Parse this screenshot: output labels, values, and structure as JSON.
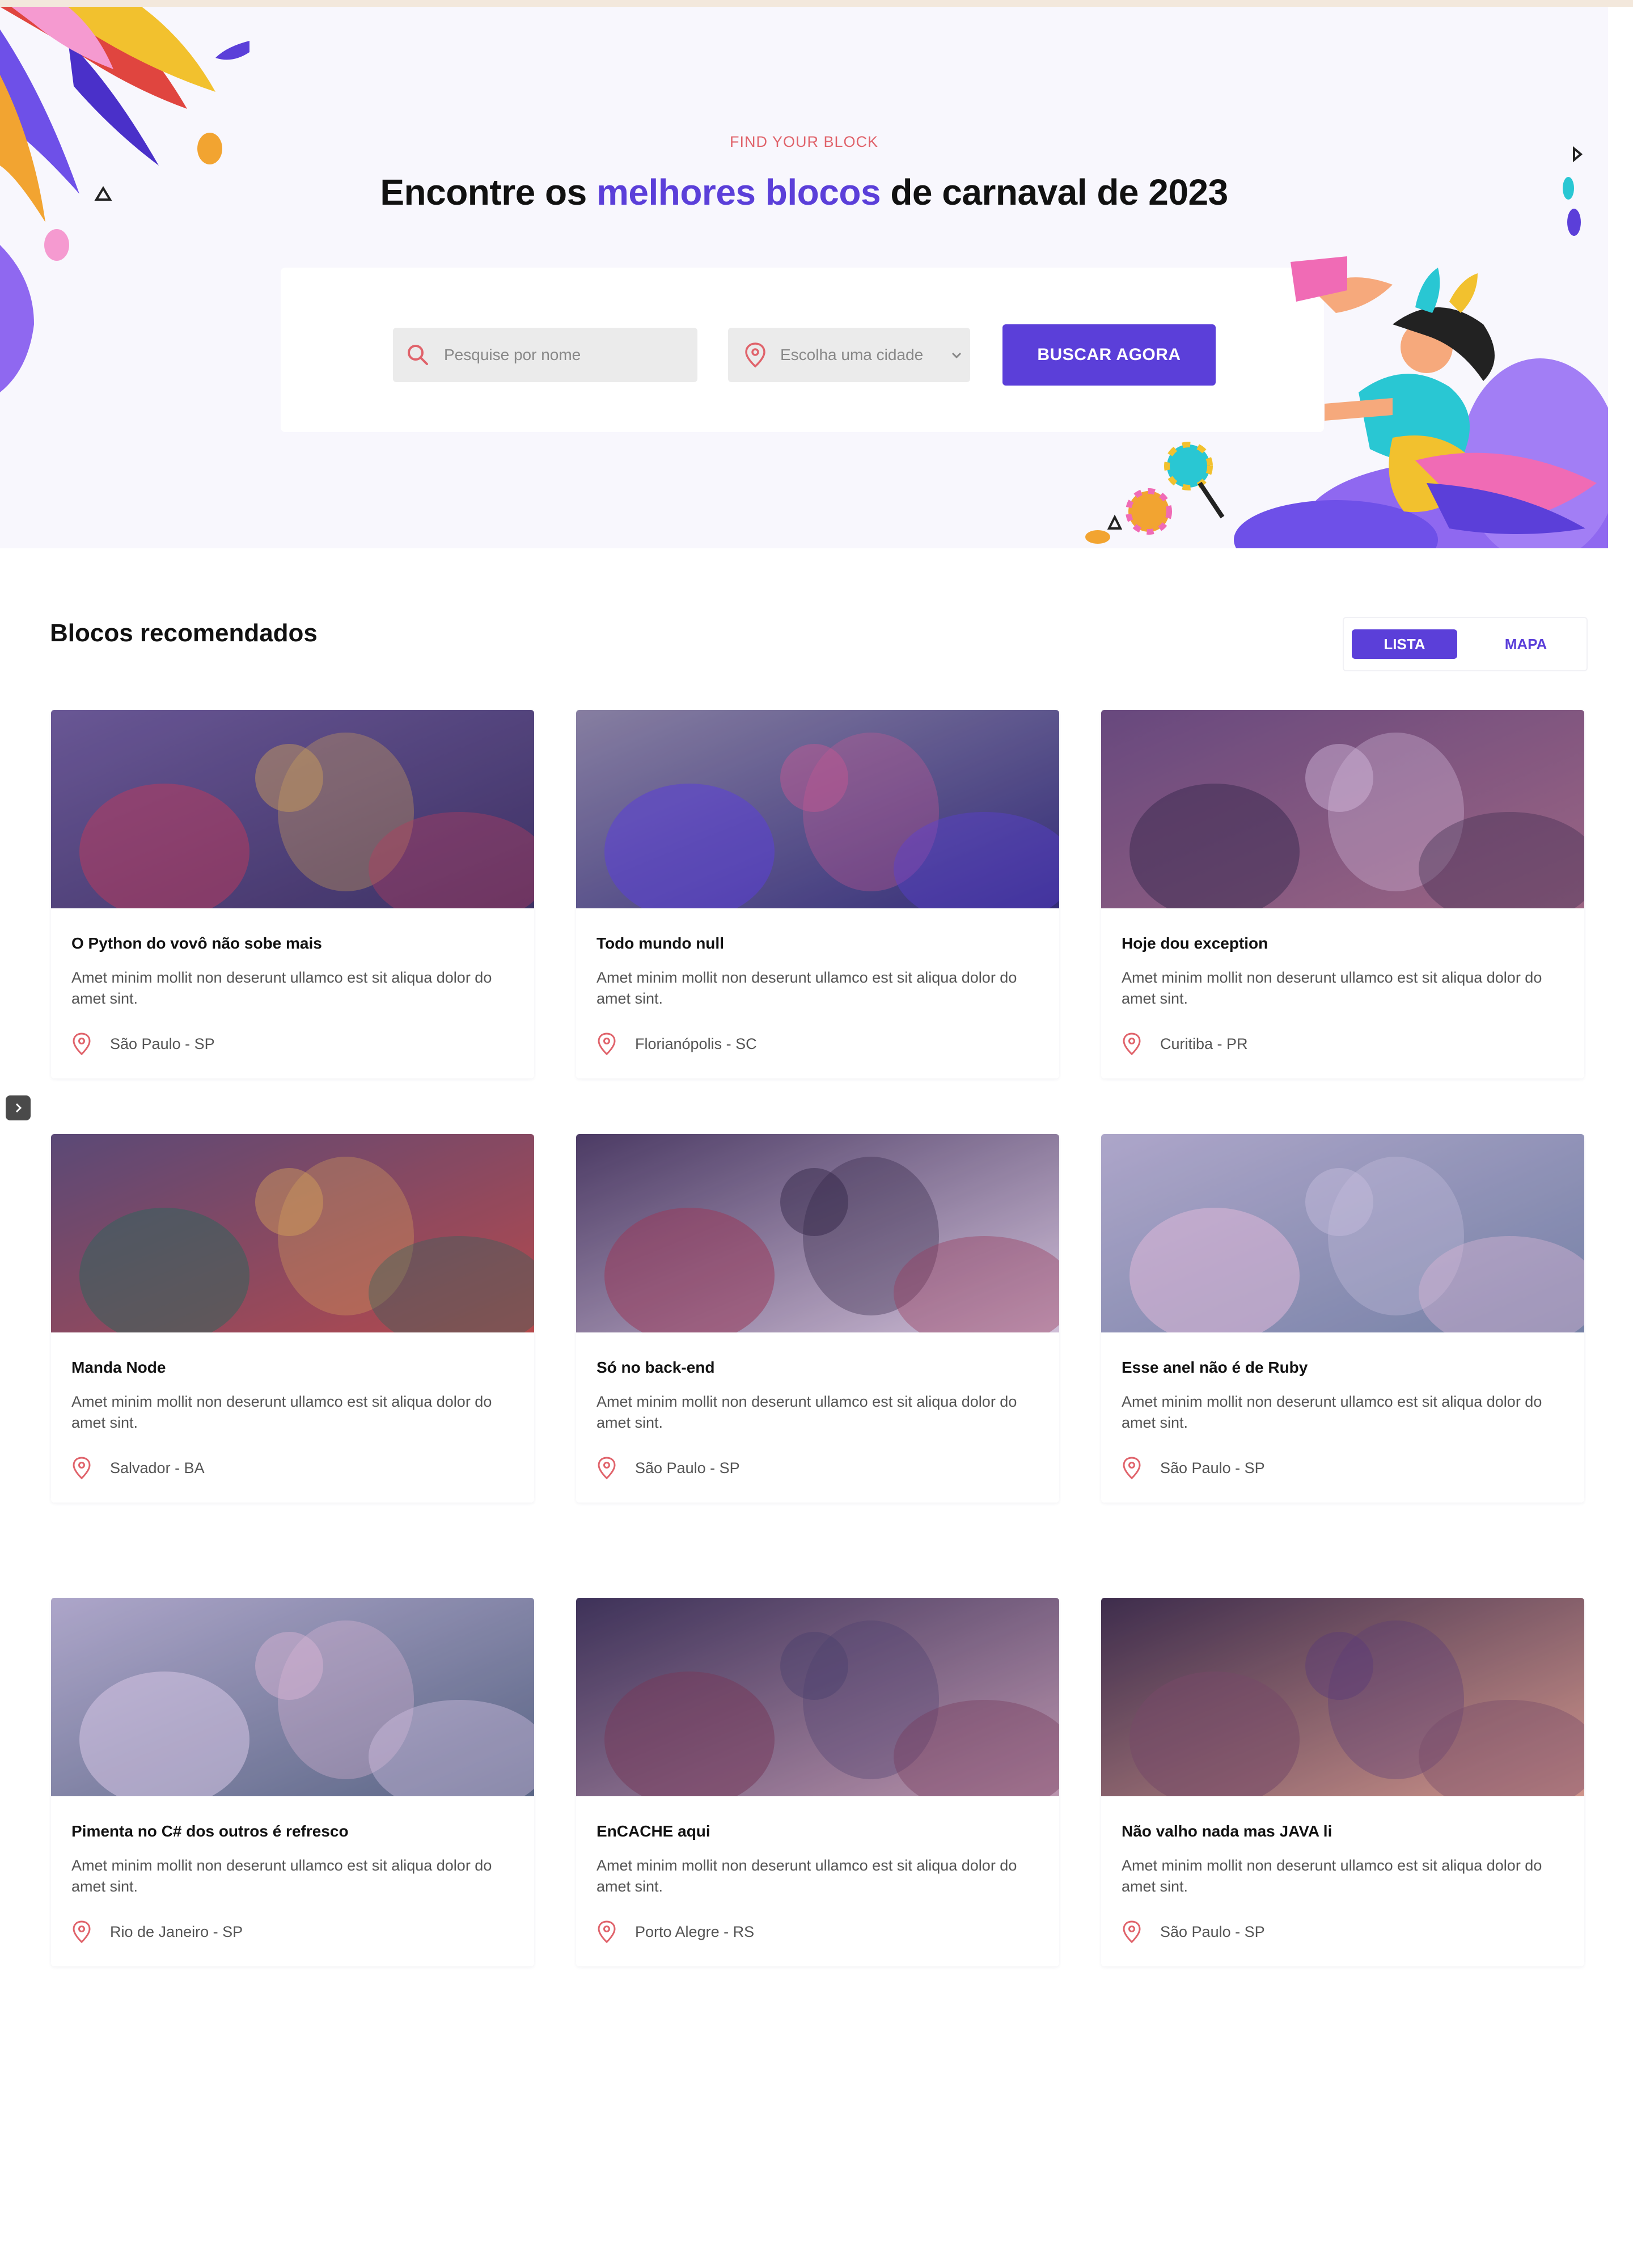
{
  "hero": {
    "eyebrow": "FIND YOUR BLOCK",
    "headline_pre": "Encontre os ",
    "headline_highlight": "melhores blocos",
    "headline_post": " de carnaval de 2023"
  },
  "search": {
    "name_placeholder": "Pesquise por nome",
    "city_placeholder": "Escolha uma cidade",
    "button_label": "BUSCAR AGORA"
  },
  "section": {
    "title": "Blocos recomendados",
    "toggle": {
      "list_label": "LISTA",
      "map_label": "MAPA",
      "active": "LISTA"
    }
  },
  "cards": [
    {
      "title": "O Python do vovô não sobe mais",
      "desc": "Amet minim mollit non deserunt ullamco est sit aliqua dolor do amet sint.",
      "location": "São Paulo - SP"
    },
    {
      "title": "Todo mundo null",
      "desc": "Amet minim mollit non deserunt ullamco est sit aliqua dolor do amet sint.",
      "location": "Florianópolis - SC"
    },
    {
      "title": "Hoje dou exception",
      "desc": "Amet minim mollit non deserunt ullamco est sit aliqua dolor do amet sint.",
      "location": "Curitiba - PR"
    },
    {
      "title": "Manda Node",
      "desc": "Amet minim mollit non deserunt ullamco est sit aliqua dolor do amet sint.",
      "location": "Salvador - BA"
    },
    {
      "title": "Só no back-end",
      "desc": "Amet minim mollit non deserunt ullamco est sit aliqua dolor do amet sint.",
      "location": "São Paulo - SP"
    },
    {
      "title": "Esse anel não é de Ruby",
      "desc": "Amet minim mollit non deserunt ullamco est sit aliqua dolor do amet sint.",
      "location": "São Paulo - SP"
    },
    {
      "title": "Pimenta no C# dos outros é refresco",
      "desc": "Amet minim mollit non deserunt ullamco est sit aliqua dolor do amet sint.",
      "location": "Rio de Janeiro - SP"
    },
    {
      "title": "EnCACHE aqui",
      "desc": "Amet minim mollit non deserunt ullamco est sit aliqua dolor do amet sint.",
      "location": "Porto Alegre - RS"
    },
    {
      "title": "Não valho nada mas JAVA li",
      "desc": "Amet minim mollit non deserunt ullamco est sit aliqua dolor do amet sint.",
      "location": "São Paulo - SP"
    }
  ],
  "colors": {
    "accent": "#5b3fd9",
    "eyebrow": "#e0636b",
    "pin": "#e0636b"
  }
}
